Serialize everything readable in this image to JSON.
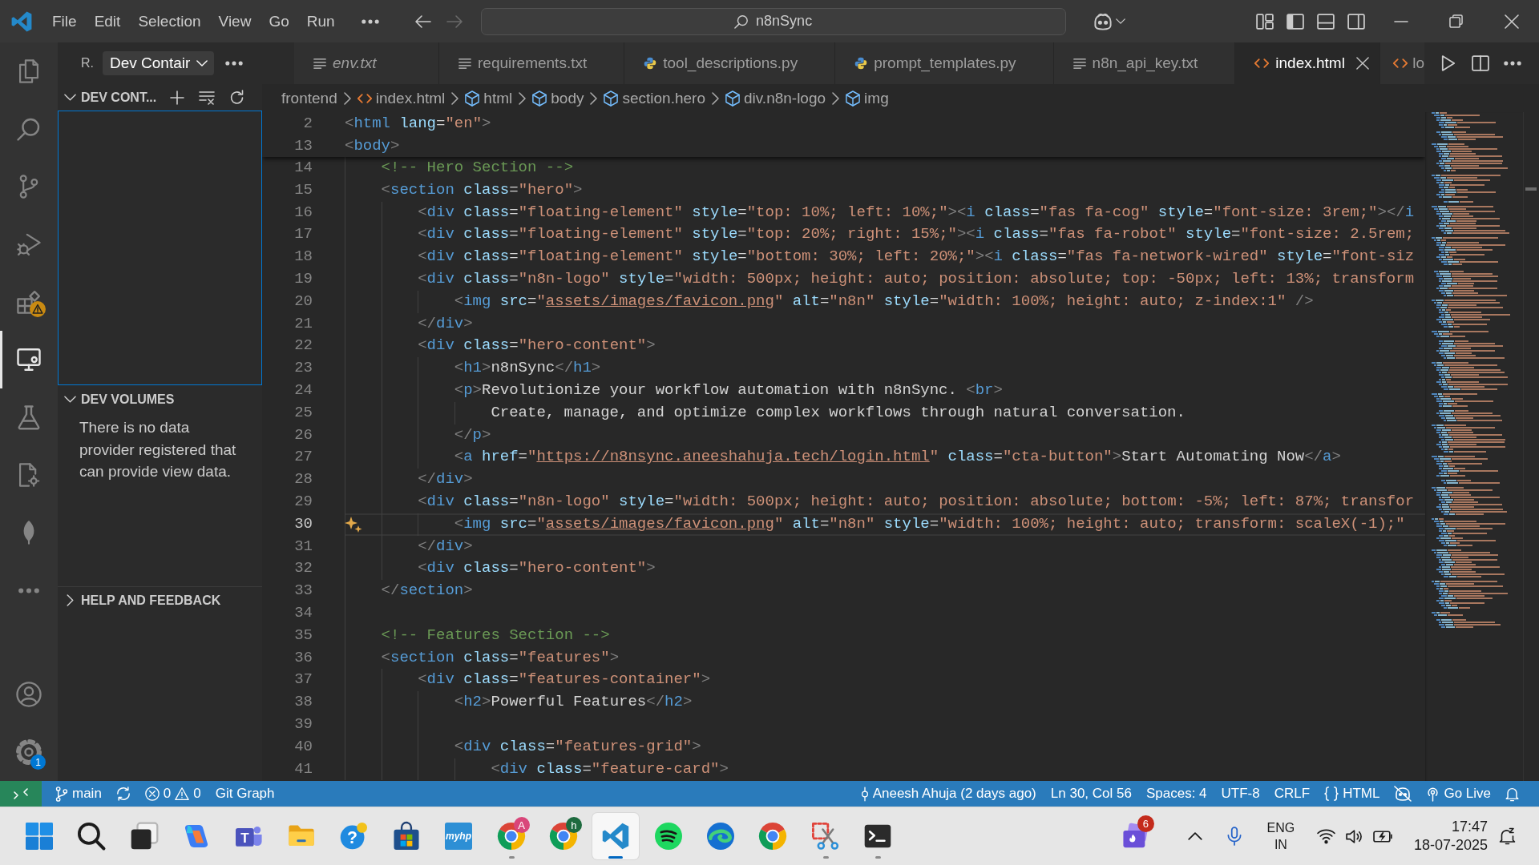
{
  "title_bar": {
    "menus": [
      "File",
      "Edit",
      "Selection",
      "View",
      "Go",
      "Run"
    ],
    "navigation": [
      {
        "disabled": false
      },
      {
        "disabled": true
      }
    ],
    "command_center": {
      "label": "n8nSync"
    },
    "layout_toggles": [
      {
        "on": true
      },
      {
        "on": false
      },
      {
        "on": false
      }
    ]
  },
  "activity_bar": {
    "items": [
      {
        "selected": false,
        "warning": false
      },
      {
        "selected": false,
        "warning": false
      },
      {
        "selected": false,
        "warning": false
      },
      {
        "selected": false,
        "warning": false
      },
      {
        "selected": false,
        "warning": true
      },
      {
        "selected": true,
        "warning": false
      },
      {
        "selected": false,
        "warning": false
      },
      {
        "selected": false,
        "warning": false
      },
      {
        "selected": false,
        "warning": false
      },
      {
        "selected": false,
        "warning": false
      }
    ],
    "settings_badge": "1"
  },
  "sidebar": {
    "title": "R.",
    "view_picker": {
      "label": "Dev Contair"
    },
    "sections": [
      {
        "title": "DEV CONT...",
        "expanded": true,
        "focused": true
      },
      {
        "title": "DEV VOLUMES",
        "expanded": true,
        "focused": false,
        "message": "There is no data provider registered that can provide view data."
      },
      {
        "title": "HELP AND FEEDBACK",
        "expanded": false,
        "focused": false
      }
    ]
  },
  "tabs": [
    {
      "label": "env.txt",
      "kind": "text",
      "preview": true,
      "selected": false
    },
    {
      "label": "requirements.txt",
      "kind": "text",
      "preview": false,
      "selected": false
    },
    {
      "label": "tool_descriptions.py",
      "kind": "python",
      "preview": false,
      "selected": false
    },
    {
      "label": "prompt_templates.py",
      "kind": "python",
      "preview": false,
      "selected": false
    },
    {
      "label": "n8n_api_key.txt",
      "kind": "text",
      "preview": false,
      "selected": false
    },
    {
      "label": "index.html",
      "kind": "html",
      "preview": false,
      "selected": true
    },
    {
      "label": "lo",
      "kind": "html",
      "preview": false,
      "selected": false
    }
  ],
  "breadcrumbs": [
    {
      "label": "frontend",
      "kind": "folder"
    },
    {
      "label": "index.html",
      "kind": "html"
    },
    {
      "label": "html",
      "kind": "element"
    },
    {
      "label": "body",
      "kind": "element"
    },
    {
      "label": "section.hero",
      "kind": "element"
    },
    {
      "label": "div.n8n-logo",
      "kind": "element"
    },
    {
      "label": "img",
      "kind": "element"
    }
  ],
  "editor": {
    "sticky_lines": [
      {
        "number": "2",
        "tokens": [
          {
            "kind": "punct",
            "text": "<"
          },
          {
            "kind": "tag",
            "text": "html"
          },
          {
            "kind": "attr",
            "text": " lang"
          },
          {
            "kind": "eq",
            "text": "="
          },
          {
            "kind": "string",
            "text": "\"en\""
          },
          {
            "kind": "punct",
            "text": ">"
          }
        ]
      },
      {
        "number": "13",
        "tokens": [
          {
            "kind": "punct",
            "text": "<"
          },
          {
            "kind": "tag",
            "text": "body"
          },
          {
            "kind": "punct",
            "text": ">"
          }
        ]
      }
    ],
    "lines": [
      {
        "number": "14",
        "current": false,
        "tokens": [
          {
            "kind": "comment",
            "text": "<!-- Hero Section -->"
          }
        ]
      },
      {
        "number": "15",
        "current": false,
        "tokens": [
          {
            "kind": "punct",
            "text": "<"
          },
          {
            "kind": "tag",
            "text": "section"
          },
          {
            "kind": "attr",
            "text": " class"
          },
          {
            "kind": "eq",
            "text": "="
          },
          {
            "kind": "string",
            "text": "\"hero\""
          },
          {
            "kind": "punct",
            "text": ">"
          }
        ],
        "children": [
          {
            "number": "16",
            "current": false,
            "tokens": [
              {
                "kind": "punct",
                "text": "<"
              },
              {
                "kind": "tag",
                "text": "div"
              },
              {
                "kind": "attr",
                "text": " class"
              },
              {
                "kind": "eq",
                "text": "="
              },
              {
                "kind": "string",
                "text": "\"floating-element\""
              },
              {
                "kind": "attr",
                "text": " style"
              },
              {
                "kind": "eq",
                "text": "="
              },
              {
                "kind": "string",
                "text": "\"top: 10%; left: 10%;\""
              },
              {
                "kind": "punct",
                "text": "><"
              },
              {
                "kind": "tag",
                "text": "i"
              },
              {
                "kind": "attr",
                "text": " class"
              },
              {
                "kind": "eq",
                "text": "="
              },
              {
                "kind": "string",
                "text": "\"fas fa-cog\""
              },
              {
                "kind": "attr",
                "text": " style"
              },
              {
                "kind": "eq",
                "text": "="
              },
              {
                "kind": "string",
                "text": "\"font-size: 3rem;\""
              },
              {
                "kind": "punct",
                "text": "></"
              },
              {
                "kind": "tag",
                "text": "i"
              }
            ]
          },
          {
            "number": "17",
            "current": false,
            "tokens": [
              {
                "kind": "punct",
                "text": "<"
              },
              {
                "kind": "tag",
                "text": "div"
              },
              {
                "kind": "attr",
                "text": " class"
              },
              {
                "kind": "eq",
                "text": "="
              },
              {
                "kind": "string",
                "text": "\"floating-element\""
              },
              {
                "kind": "attr",
                "text": " style"
              },
              {
                "kind": "eq",
                "text": "="
              },
              {
                "kind": "string",
                "text": "\"top: 20%; right: 15%;\""
              },
              {
                "kind": "punct",
                "text": "><"
              },
              {
                "kind": "tag",
                "text": "i"
              },
              {
                "kind": "attr",
                "text": " class"
              },
              {
                "kind": "eq",
                "text": "="
              },
              {
                "kind": "string",
                "text": "\"fas fa-robot\""
              },
              {
                "kind": "attr",
                "text": " style"
              },
              {
                "kind": "eq",
                "text": "="
              },
              {
                "kind": "string",
                "text": "\"font-size: 2.5rem;"
              }
            ]
          },
          {
            "number": "18",
            "current": false,
            "tokens": [
              {
                "kind": "punct",
                "text": "<"
              },
              {
                "kind": "tag",
                "text": "div"
              },
              {
                "kind": "attr",
                "text": " class"
              },
              {
                "kind": "eq",
                "text": "="
              },
              {
                "kind": "string",
                "text": "\"floating-element\""
              },
              {
                "kind": "attr",
                "text": " style"
              },
              {
                "kind": "eq",
                "text": "="
              },
              {
                "kind": "string",
                "text": "\"bottom: 30%; left: 20%;\""
              },
              {
                "kind": "punct",
                "text": "><"
              },
              {
                "kind": "tag",
                "text": "i"
              },
              {
                "kind": "attr",
                "text": " class"
              },
              {
                "kind": "eq",
                "text": "="
              },
              {
                "kind": "string",
                "text": "\"fas fa-network-wired\""
              },
              {
                "kind": "attr",
                "text": " style"
              },
              {
                "kind": "eq",
                "text": "="
              },
              {
                "kind": "string",
                "text": "\"font-siz"
              }
            ]
          },
          {
            "number": "19",
            "current": false,
            "tokens": [
              {
                "kind": "punct",
                "text": "<"
              },
              {
                "kind": "tag",
                "text": "div"
              },
              {
                "kind": "attr",
                "text": " class"
              },
              {
                "kind": "eq",
                "text": "="
              },
              {
                "kind": "string",
                "text": "\"n8n-logo\""
              },
              {
                "kind": "attr",
                "text": " style"
              },
              {
                "kind": "eq",
                "text": "="
              },
              {
                "kind": "string",
                "text": "\"width: 500px; height: auto; position: absolute; top: -50px; left: 13%; transform"
              }
            ],
            "children": [
              {
                "number": "20",
                "current": false,
                "tokens": [
                  {
                    "kind": "punct",
                    "text": "<"
                  },
                  {
                    "kind": "tag",
                    "text": "img"
                  },
                  {
                    "kind": "attr",
                    "text": " src"
                  },
                  {
                    "kind": "eq",
                    "text": "="
                  },
                  {
                    "kind": "string",
                    "text": "\""
                  },
                  {
                    "kind": "link",
                    "text": "assets/images/favicon.png"
                  },
                  {
                    "kind": "string",
                    "text": "\""
                  },
                  {
                    "kind": "attr",
                    "text": " alt"
                  },
                  {
                    "kind": "eq",
                    "text": "="
                  },
                  {
                    "kind": "string",
                    "text": "\"n8n\""
                  },
                  {
                    "kind": "attr",
                    "text": " style"
                  },
                  {
                    "kind": "eq",
                    "text": "="
                  },
                  {
                    "kind": "string",
                    "text": "\"width: 100%; height: auto; z-index:1\""
                  },
                  {
                    "kind": "punct",
                    "text": " />"
                  }
                ]
              }
            ]
          },
          {
            "number": "21",
            "current": false,
            "tokens": [
              {
                "kind": "punct",
                "text": "</"
              },
              {
                "kind": "tag",
                "text": "div"
              },
              {
                "kind": "punct",
                "text": ">"
              }
            ]
          },
          {
            "number": "22",
            "current": false,
            "tokens": [
              {
                "kind": "punct",
                "text": "<"
              },
              {
                "kind": "tag",
                "text": "div"
              },
              {
                "kind": "attr",
                "text": " class"
              },
              {
                "kind": "eq",
                "text": "="
              },
              {
                "kind": "string",
                "text": "\"hero-content\""
              },
              {
                "kind": "punct",
                "text": ">"
              }
            ],
            "children": [
              {
                "number": "23",
                "current": false,
                "tokens": [
                  {
                    "kind": "punct",
                    "text": "<"
                  },
                  {
                    "kind": "tag",
                    "text": "h1"
                  },
                  {
                    "kind": "punct",
                    "text": ">"
                  },
                  {
                    "kind": "text",
                    "text": "n8nSync"
                  },
                  {
                    "kind": "punct",
                    "text": "</"
                  },
                  {
                    "kind": "tag",
                    "text": "h1"
                  },
                  {
                    "kind": "punct",
                    "text": ">"
                  }
                ]
              },
              {
                "number": "24",
                "current": false,
                "tokens": [
                  {
                    "kind": "punct",
                    "text": "<"
                  },
                  {
                    "kind": "tag",
                    "text": "p"
                  },
                  {
                    "kind": "punct",
                    "text": ">"
                  },
                  {
                    "kind": "text",
                    "text": "Revolutionize your workflow automation with n8nSync. "
                  },
                  {
                    "kind": "punct",
                    "text": "<"
                  },
                  {
                    "kind": "tag",
                    "text": "br"
                  },
                  {
                    "kind": "punct",
                    "text": ">"
                  }
                ],
                "children": [
                  {
                    "number": "25",
                    "current": false,
                    "tokens": [
                      {
                        "kind": "text",
                        "text": "Create, manage, and optimize complex workflows through natural conversation."
                      }
                    ]
                  }
                ]
              },
              {
                "number": "26",
                "current": false,
                "tokens": [
                  {
                    "kind": "punct",
                    "text": "</"
                  },
                  {
                    "kind": "tag",
                    "text": "p"
                  },
                  {
                    "kind": "punct",
                    "text": ">"
                  }
                ]
              },
              {
                "number": "27",
                "current": false,
                "tokens": [
                  {
                    "kind": "punct",
                    "text": "<"
                  },
                  {
                    "kind": "tag",
                    "text": "a"
                  },
                  {
                    "kind": "attr",
                    "text": " href"
                  },
                  {
                    "kind": "eq",
                    "text": "="
                  },
                  {
                    "kind": "string",
                    "text": "\""
                  },
                  {
                    "kind": "link",
                    "text": "https://n8nsync.aneeshahuja.tech/login.html"
                  },
                  {
                    "kind": "string",
                    "text": "\""
                  },
                  {
                    "kind": "attr",
                    "text": " class"
                  },
                  {
                    "kind": "eq",
                    "text": "="
                  },
                  {
                    "kind": "string",
                    "text": "\"cta-button\""
                  },
                  {
                    "kind": "punct",
                    "text": ">"
                  },
                  {
                    "kind": "text",
                    "text": "Start Automating Now"
                  },
                  {
                    "kind": "punct",
                    "text": "</"
                  },
                  {
                    "kind": "tag",
                    "text": "a"
                  },
                  {
                    "kind": "punct",
                    "text": ">"
                  }
                ]
              }
            ]
          },
          {
            "number": "28",
            "current": false,
            "tokens": [
              {
                "kind": "punct",
                "text": "</"
              },
              {
                "kind": "tag",
                "text": "div"
              },
              {
                "kind": "punct",
                "text": ">"
              }
            ]
          },
          {
            "number": "29",
            "current": false,
            "tokens": [
              {
                "kind": "punct",
                "text": "<"
              },
              {
                "kind": "tag",
                "text": "div"
              },
              {
                "kind": "attr",
                "text": " class"
              },
              {
                "kind": "eq",
                "text": "="
              },
              {
                "kind": "string",
                "text": "\"n8n-logo\""
              },
              {
                "kind": "attr",
                "text": " style"
              },
              {
                "kind": "eq",
                "text": "="
              },
              {
                "kind": "string",
                "text": "\"width: 500px; height: auto; position: absolute; bottom: -5%; left: 87%; transfor"
              }
            ],
            "children": [
              {
                "number": "30",
                "current": true,
                "tokens": [
                  {
                    "kind": "punct",
                    "text": "<"
                  },
                  {
                    "kind": "tag",
                    "text": "img"
                  },
                  {
                    "kind": "attr",
                    "text": " src"
                  },
                  {
                    "kind": "eq",
                    "text": "="
                  },
                  {
                    "kind": "string",
                    "text": "\""
                  },
                  {
                    "kind": "link",
                    "text": "assets/images/favicon.png"
                  },
                  {
                    "kind": "string",
                    "text": "\""
                  },
                  {
                    "kind": "attr",
                    "text": " alt"
                  },
                  {
                    "kind": "eq",
                    "text": "="
                  },
                  {
                    "kind": "string",
                    "text": "\"n8n\""
                  },
                  {
                    "kind": "attr",
                    "text": " style"
                  },
                  {
                    "kind": "eq",
                    "text": "="
                  },
                  {
                    "kind": "string",
                    "text": "\"width: 100%; height: auto; transform: scaleX(-1);\""
                  }
                ]
              }
            ]
          },
          {
            "number": "31",
            "current": false,
            "tokens": [
              {
                "kind": "punct",
                "text": "</"
              },
              {
                "kind": "tag",
                "text": "div"
              },
              {
                "kind": "punct",
                "text": ">"
              }
            ]
          },
          {
            "number": "32",
            "current": false,
            "tokens": [
              {
                "kind": "punct",
                "text": "<"
              },
              {
                "kind": "tag",
                "text": "div"
              },
              {
                "kind": "attr",
                "text": " class"
              },
              {
                "kind": "eq",
                "text": "="
              },
              {
                "kind": "string",
                "text": "\"hero-content\""
              },
              {
                "kind": "punct",
                "text": ">"
              }
            ]
          }
        ]
      },
      {
        "number": "33",
        "current": false,
        "tokens": [
          {
            "kind": "punct",
            "text": "</"
          },
          {
            "kind": "tag",
            "text": "section"
          },
          {
            "kind": "punct",
            "text": ">"
          }
        ]
      },
      {
        "number": "34",
        "current": false
      },
      {
        "number": "35",
        "current": false,
        "tokens": [
          {
            "kind": "comment",
            "text": "<!-- Features Section -->"
          }
        ]
      },
      {
        "number": "36",
        "current": false,
        "tokens": [
          {
            "kind": "punct",
            "text": "<"
          },
          {
            "kind": "tag",
            "text": "section"
          },
          {
            "kind": "attr",
            "text": " class"
          },
          {
            "kind": "eq",
            "text": "="
          },
          {
            "kind": "string",
            "text": "\"features\""
          },
          {
            "kind": "punct",
            "text": ">"
          }
        ],
        "children": [
          {
            "number": "37",
            "current": false,
            "tokens": [
              {
                "kind": "punct",
                "text": "<"
              },
              {
                "kind": "tag",
                "text": "div"
              },
              {
                "kind": "attr",
                "text": " class"
              },
              {
                "kind": "eq",
                "text": "="
              },
              {
                "kind": "string",
                "text": "\"features-container\""
              },
              {
                "kind": "punct",
                "text": ">"
              }
            ],
            "children": [
              {
                "number": "38",
                "current": false,
                "tokens": [
                  {
                    "kind": "punct",
                    "text": "<"
                  },
                  {
                    "kind": "tag",
                    "text": "h2"
                  },
                  {
                    "kind": "punct",
                    "text": ">"
                  },
                  {
                    "kind": "text",
                    "text": "Powerful Features"
                  },
                  {
                    "kind": "punct",
                    "text": "</"
                  },
                  {
                    "kind": "tag",
                    "text": "h2"
                  },
                  {
                    "kind": "punct",
                    "text": ">"
                  }
                ]
              },
              {
                "number": "39",
                "current": false
              },
              {
                "number": "40",
                "current": false,
                "tokens": [
                  {
                    "kind": "punct",
                    "text": "<"
                  },
                  {
                    "kind": "tag",
                    "text": "div"
                  },
                  {
                    "kind": "attr",
                    "text": " class"
                  },
                  {
                    "kind": "eq",
                    "text": "="
                  },
                  {
                    "kind": "string",
                    "text": "\"features-grid\""
                  },
                  {
                    "kind": "punct",
                    "text": ">"
                  }
                ],
                "children": [
                  {
                    "number": "41",
                    "current": false,
                    "tokens": [
                      {
                        "kind": "punct",
                        "text": "<"
                      },
                      {
                        "kind": "tag",
                        "text": "div"
                      },
                      {
                        "kind": "attr",
                        "text": " class"
                      },
                      {
                        "kind": "eq",
                        "text": "="
                      },
                      {
                        "kind": "string",
                        "text": "\"feature-card\""
                      },
                      {
                        "kind": "punct",
                        "text": ">"
                      }
                    ]
                  }
                ]
              }
            ]
          }
        ]
      }
    ]
  },
  "status_bar": {
    "left": [
      {
        "kind": "remote"
      },
      {
        "kind": "branch",
        "label": "main"
      },
      {
        "kind": "sync"
      },
      {
        "kind": "problems",
        "errors": "0",
        "warnings": "0"
      },
      {
        "kind": "plain",
        "label": "Git Graph"
      }
    ],
    "right": [
      {
        "kind": "blame",
        "label": "Aneesh Ahuja (2 days ago)"
      },
      {
        "kind": "plain",
        "label": "Ln 30, Col 56"
      },
      {
        "kind": "plain",
        "label": "Spaces: 4"
      },
      {
        "kind": "plain",
        "label": "UTF-8"
      },
      {
        "kind": "plain",
        "label": "CRLF"
      },
      {
        "kind": "language",
        "label": "HTML"
      },
      {
        "kind": "copilot"
      },
      {
        "kind": "live",
        "label": "Go Live"
      },
      {
        "kind": "bell"
      }
    ]
  },
  "taskbar": {
    "apps": [
      {
        "running": false,
        "selected": false
      },
      {
        "running": false,
        "selected": false
      },
      {
        "running": false,
        "selected": false
      },
      {
        "running": false,
        "selected": false
      },
      {
        "running": false,
        "selected": false,
        "logo_text": "T"
      },
      {
        "running": false,
        "selected": false
      },
      {
        "running": false,
        "selected": false,
        "logo_text": "?"
      },
      {
        "running": false,
        "selected": false
      },
      {
        "running": false,
        "selected": false,
        "logo_text": "myhp"
      },
      {
        "running": true,
        "selected": false,
        "avatar": "A",
        "color": "#d9467a"
      },
      {
        "running": false,
        "selected": false,
        "avatar": "h",
        "color": "#1e6b3f"
      },
      {
        "running": true,
        "selected": true
      },
      {
        "running": false,
        "selected": false
      },
      {
        "running": false,
        "selected": false
      },
      {
        "running": false,
        "selected": false
      },
      {
        "running": true,
        "selected": false
      },
      {
        "running": true,
        "selected": false
      }
    ],
    "tray": {
      "notification_badge": "6",
      "language": {
        "code": "ENG",
        "region": "IN"
      },
      "time": "17:47",
      "date": "18-07-2025"
    }
  }
}
